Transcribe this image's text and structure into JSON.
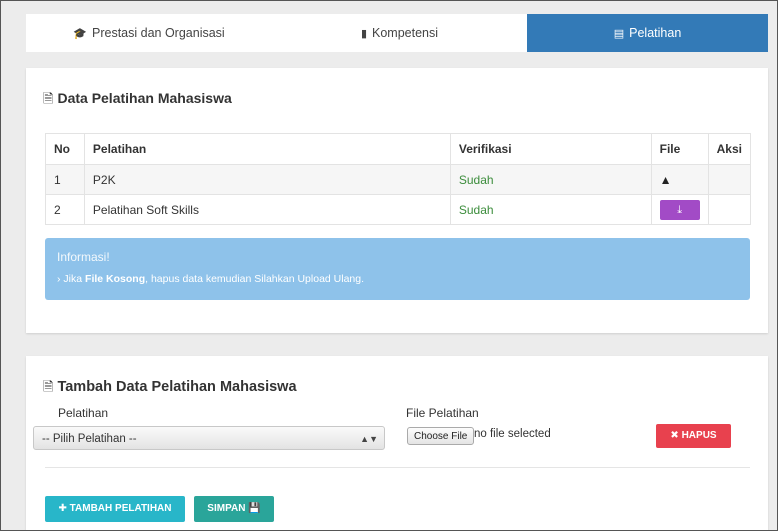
{
  "tabs": [
    {
      "label": "Prestasi dan Organisasi",
      "icon": "graduation-cap-icon",
      "glyph": "🎓"
    },
    {
      "label": "Kompetensi",
      "icon": "book-icon",
      "glyph": "📕"
    },
    {
      "label": "Pelatihan",
      "icon": "list-icon",
      "glyph": "▤",
      "active": true
    }
  ],
  "data_section": {
    "title": "Data Pelatihan Mahasiswa",
    "icon": "document-icon",
    "columns": [
      "No",
      "Pelatihan",
      "Verifikasi",
      "File",
      "Aksi"
    ],
    "rows": [
      {
        "no": "1",
        "pelatihan": "P2K",
        "verifikasi": "Sudah",
        "file": "warning-icon"
      },
      {
        "no": "2",
        "pelatihan": "Pelatihan Soft Skills",
        "verifikasi": "Sudah",
        "file": "download-button"
      }
    ]
  },
  "info": {
    "title": "Informasi!",
    "bullet": "›",
    "prefix": "Jika",
    "bold": "File Kosong",
    "rest": ", hapus data kemudian Silahkan Upload Ulang."
  },
  "form": {
    "title": "Tambah Data Pelatihan Mahasiswa",
    "pelatihan_label": "Pelatihan",
    "select_value": "-- Pilih Pelatihan --",
    "file_label": "File Pelatihan",
    "choose_file": "Choose File",
    "file_status": "no file selected",
    "hapus": "HAPUS",
    "tambah": "TAMBAH PELATIHAN",
    "simpan": "SIMPAN"
  },
  "colors": {
    "tab_active": "#337ab7",
    "download": "#a24bc6",
    "info": "#8ec2ea",
    "hapus": "#e8414e",
    "tambah": "#28b6c9",
    "simpan": "#2aa59a",
    "verified": "#3c8d3c"
  }
}
